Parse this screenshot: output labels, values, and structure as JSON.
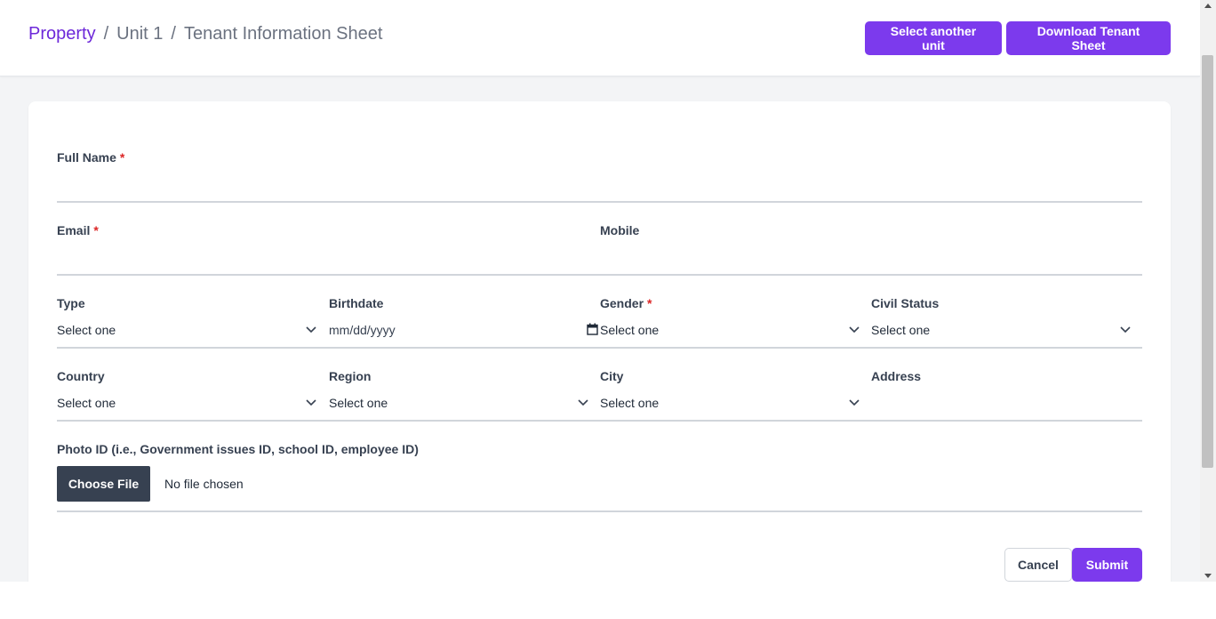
{
  "breadcrumb": {
    "property": "Property",
    "separator": "/",
    "unit": "Unit 1",
    "page": "Tenant Information Sheet"
  },
  "header": {
    "select_unit_label": "Select another unit",
    "download_label": "Download Tenant Sheet"
  },
  "form": {
    "required_mark": "*",
    "full_name": {
      "label": "Full Name",
      "value": ""
    },
    "email": {
      "label": "Email",
      "value": ""
    },
    "mobile": {
      "label": "Mobile",
      "value": ""
    },
    "type": {
      "label": "Type",
      "value": "Select one"
    },
    "birthdate": {
      "label": "Birthdate",
      "placeholder": "mm/dd/yyyy"
    },
    "gender": {
      "label": "Gender",
      "value": "Select one"
    },
    "civil_status": {
      "label": "Civil Status",
      "value": "Select one"
    },
    "country": {
      "label": "Country",
      "value": "Select one"
    },
    "region": {
      "label": "Region",
      "value": "Select one"
    },
    "city": {
      "label": "City",
      "value": "Select one"
    },
    "address": {
      "label": "Address",
      "value": ""
    },
    "photo_id": {
      "label": "Photo ID (i.e., Government issues ID, school ID, employee ID)",
      "button": "Choose File",
      "status": "No file chosen"
    }
  },
  "actions": {
    "cancel": "Cancel",
    "submit": "Submit"
  },
  "icons": {
    "select_arrow": "chevron-down-icon",
    "date_picker": "calendar-icon"
  },
  "colors": {
    "accent": "#7c3aed",
    "link": "#6d28d9",
    "required": "#dc2626",
    "file_button": "#374151",
    "background": "#f3f4f6"
  }
}
